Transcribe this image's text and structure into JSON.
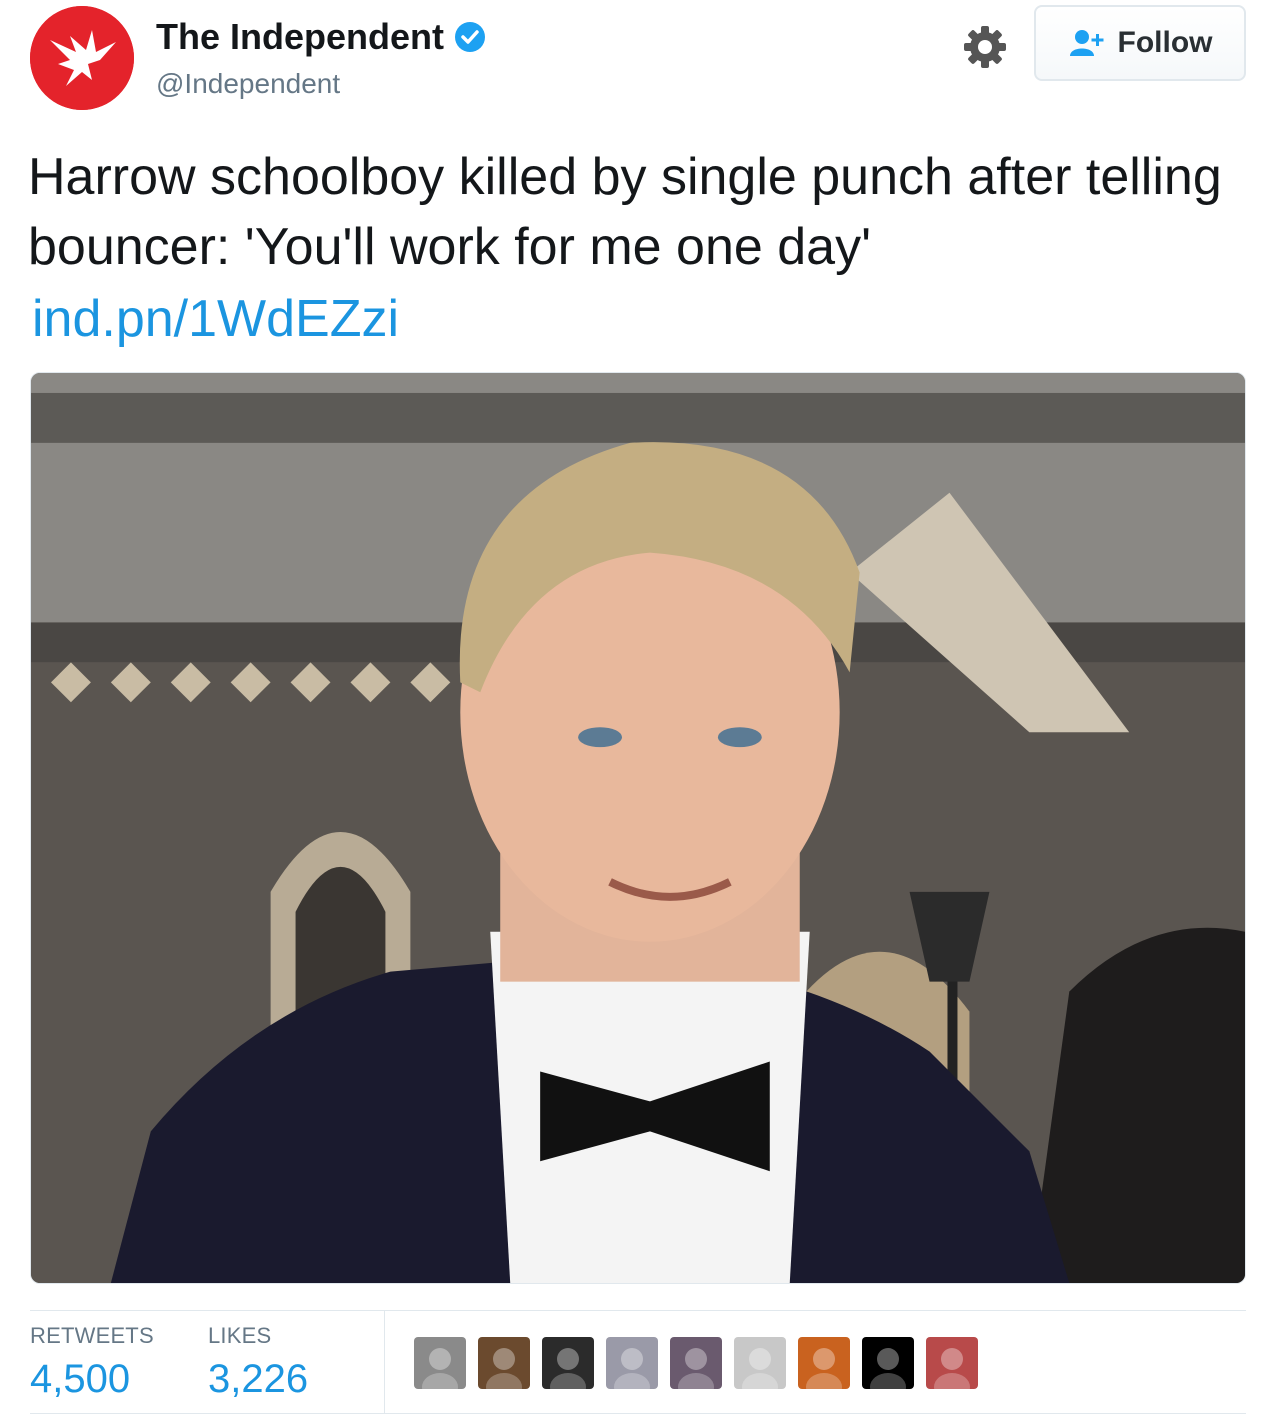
{
  "account": {
    "name": "The Independent",
    "handle": "@Independent",
    "verified": true,
    "brand_color": "#e4232b"
  },
  "actions": {
    "settings_icon": "gear-icon",
    "follow_label": "Follow",
    "follow_icon": "add-user-icon"
  },
  "tweet": {
    "text": "Harrow schoolboy killed by single punch after telling bouncer: 'You'll work for me one day'",
    "link": "ind.pn/1WdEZzi",
    "link_color": "#1b95e0"
  },
  "stats": {
    "retweets_label": "RETWEETS",
    "retweets_value": "4,500",
    "likes_label": "LIKES",
    "likes_value": "3,226"
  },
  "likers": [
    {
      "name": "liker-avatar-1",
      "color": "#8a8a8a"
    },
    {
      "name": "liker-avatar-2",
      "color": "#6b4a2e"
    },
    {
      "name": "liker-avatar-3",
      "color": "#2b2b2b"
    },
    {
      "name": "liker-avatar-4",
      "color": "#9a9aa8"
    },
    {
      "name": "liker-avatar-5",
      "color": "#6a5a6e"
    },
    {
      "name": "liker-avatar-6",
      "color": "#c8c8c8"
    },
    {
      "name": "liker-avatar-7",
      "color": "#c9621f"
    },
    {
      "name": "liker-avatar-8",
      "color": "#000000"
    },
    {
      "name": "liker-avatar-9",
      "color": "#b84a4a"
    }
  ]
}
